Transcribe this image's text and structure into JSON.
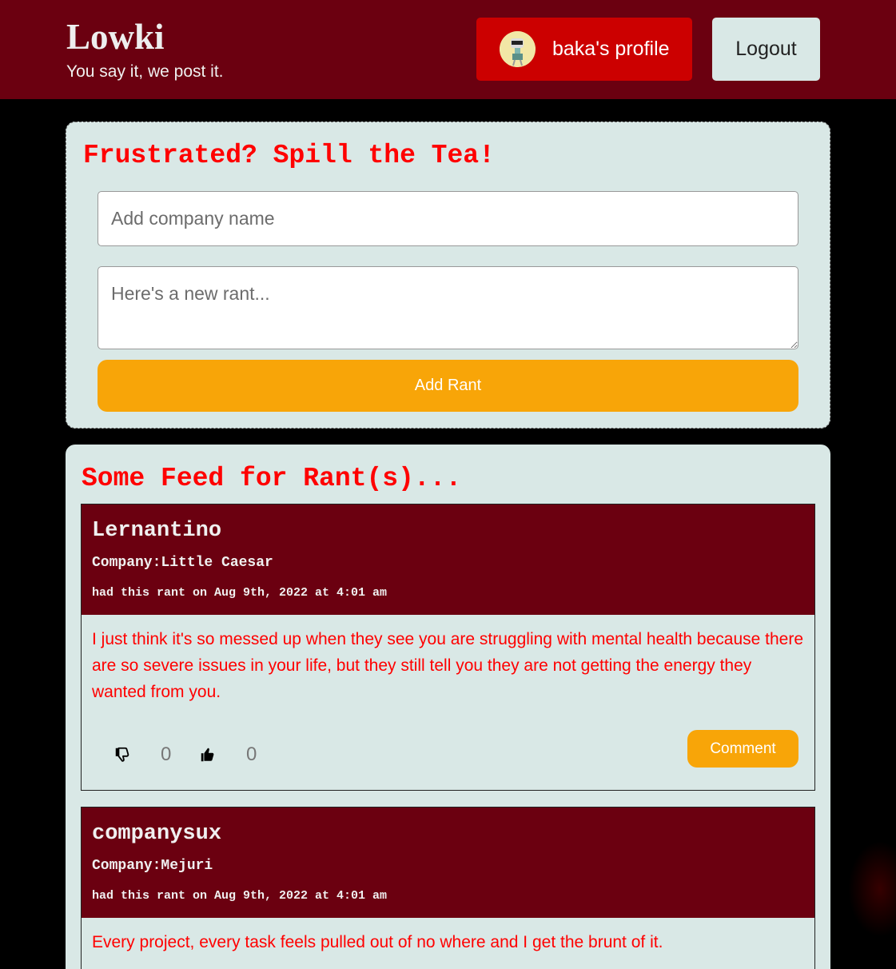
{
  "header": {
    "brand": "Lowki",
    "tagline": "You say it, we post it.",
    "profile_label": "baka's profile",
    "logout_label": "Logout"
  },
  "compose": {
    "title": "Frustrated? Spill the Tea!",
    "company_placeholder": "Add company name",
    "rant_placeholder": "Here's a new rant...",
    "submit_label": "Add Rant"
  },
  "feed": {
    "title": "Some Feed for Rant(s)...",
    "rants": [
      {
        "user": "Lernantino",
        "company": "Company:Little Caesar",
        "date": "had this rant on Aug 9th, 2022 at 4:01 am",
        "text": "I just think it's so messed up when they see you are struggling with mental health because there are so severe issues in your life, but they still tell you they are not getting the energy they wanted from you.",
        "downvotes": "0",
        "upvotes": "0",
        "comment_label": "Comment"
      },
      {
        "user": "companysux",
        "company": "Company:Mejuri",
        "date": "had this rant on Aug 9th, 2022 at 4:01 am",
        "text": "Every project, every task feels pulled out of no where and I get the brunt of it."
      }
    ]
  },
  "colors": {
    "header_bg": "#6b0010",
    "profile_btn": "#cc0000",
    "card_bg": "#d9e8e6",
    "accent_orange": "#f8a508",
    "title_red": "#ff0000"
  },
  "icons": [
    "avatar",
    "thumbs-down-icon",
    "thumbs-up-icon"
  ]
}
